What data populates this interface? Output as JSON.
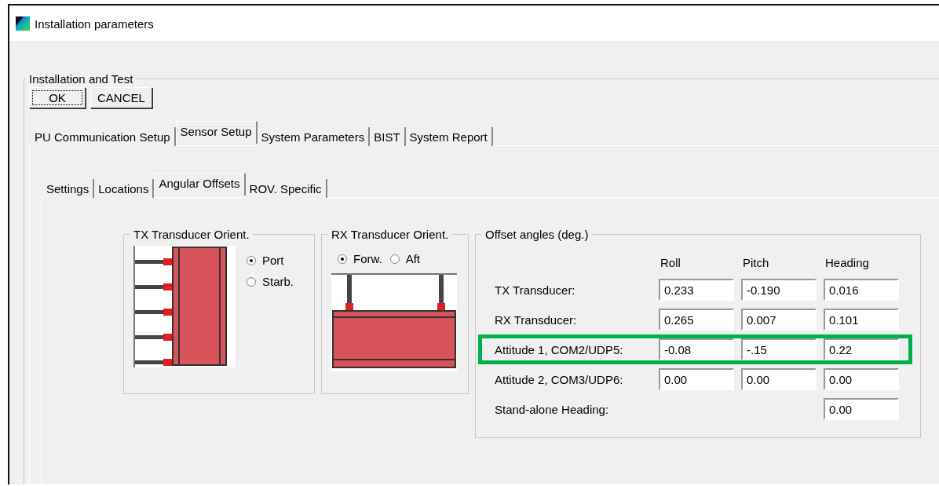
{
  "window": {
    "title": "Installation parameters"
  },
  "group": {
    "title": "Installation and Test"
  },
  "buttons": [
    {
      "label": "OK",
      "focused": true
    },
    {
      "label": "CANCEL",
      "focused": false
    }
  ],
  "tabs": [
    {
      "label": "PU Communication Setup",
      "selected": false
    },
    {
      "label": "Sensor Setup",
      "selected": true
    },
    {
      "label": "System Parameters",
      "selected": false
    },
    {
      "label": "BIST",
      "selected": false
    },
    {
      "label": "System Report",
      "selected": false
    }
  ],
  "subtabs": [
    {
      "label": "Settings",
      "selected": false
    },
    {
      "label": "Locations",
      "selected": false
    },
    {
      "label": "Angular Offsets",
      "selected": true
    },
    {
      "label": "ROV. Specific",
      "selected": false
    }
  ],
  "tx_orient": {
    "title": "TX Transducer Orient.",
    "options": [
      {
        "label": "Port",
        "selected": true
      },
      {
        "label": "Starb.",
        "selected": false
      }
    ]
  },
  "rx_orient": {
    "title": "RX Transducer Orient.",
    "options": [
      {
        "label": "Forw.",
        "selected": true
      },
      {
        "label": "Aft",
        "selected": false
      }
    ]
  },
  "offsets": {
    "title": "Offset angles (deg.)",
    "columns": [
      "Roll",
      "Pitch",
      "Heading"
    ],
    "rows": [
      {
        "label": "TX Transducer:",
        "roll": "0.233",
        "pitch": "-0.190",
        "heading": "0.016",
        "highlighted": false
      },
      {
        "label": "RX Transducer:",
        "roll": "0.265",
        "pitch": "0.007",
        "heading": "0.101",
        "highlighted": false
      },
      {
        "label": "Attitude 1, COM2/UDP5:",
        "roll": "-0.08",
        "pitch": "-.15",
        "heading": "0.22",
        "highlighted": true
      },
      {
        "label": "Attitude 2, COM3/UDP6:",
        "roll": "0.00",
        "pitch": "0.00",
        "heading": "0.00",
        "highlighted": false
      },
      {
        "label": "Stand-alone Heading:",
        "heading": "0.00",
        "highlighted": false
      }
    ]
  }
}
